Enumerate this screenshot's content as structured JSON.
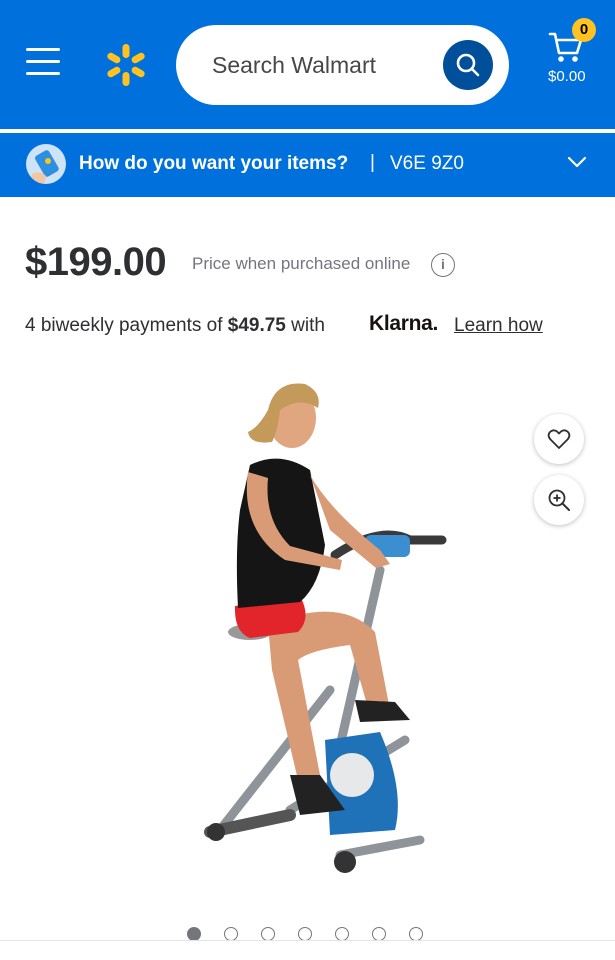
{
  "header": {
    "search_placeholder": "Search Walmart",
    "cart": {
      "count": "0",
      "total": "$0.00"
    },
    "colors": {
      "brand_blue": "#0071dc",
      "spark_yellow": "#ffc220",
      "search_button": "#004f9a"
    }
  },
  "delivery": {
    "question": "How do you want your items?",
    "separator": "|",
    "zip": "V6E 9Z0"
  },
  "product": {
    "price": "$199.00",
    "price_note": "Price when purchased online",
    "payments_prefix": "4 biweekly payments of ",
    "payment_amount": "$49.75",
    "payments_with": " with",
    "klarna_logo": "Klarna.",
    "learn_link": "Learn how",
    "image_alt": "Folding exercise bike with woman riding",
    "gallery": {
      "total": 7,
      "active_index": 0
    }
  },
  "icons": {
    "menu": "hamburger-icon",
    "logo": "walmart-spark-icon",
    "search": "search-icon",
    "cart": "cart-icon",
    "location": "location-phone-icon",
    "chevron": "chevron-down-icon",
    "info": "info-icon",
    "favorite": "heart-icon",
    "zoom": "zoom-in-icon"
  }
}
